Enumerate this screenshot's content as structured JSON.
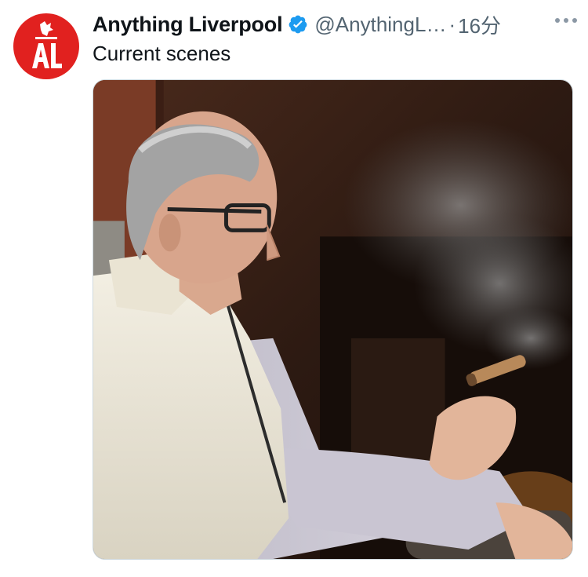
{
  "tweet": {
    "author_name": "Anything Liverpool",
    "handle": "@AnythingL…",
    "separator": "·",
    "time": "16分",
    "text": "Current scenes",
    "icons": {
      "avatar": "liverbird-al-logo",
      "verified": "verified-badge-icon",
      "more": "more-options-icon"
    },
    "media": {
      "description_icon": "photo"
    }
  },
  "colors": {
    "brand": "#e1211f",
    "verified": "#1d9bf0",
    "muted": "#536471",
    "text": "#0f1419"
  }
}
